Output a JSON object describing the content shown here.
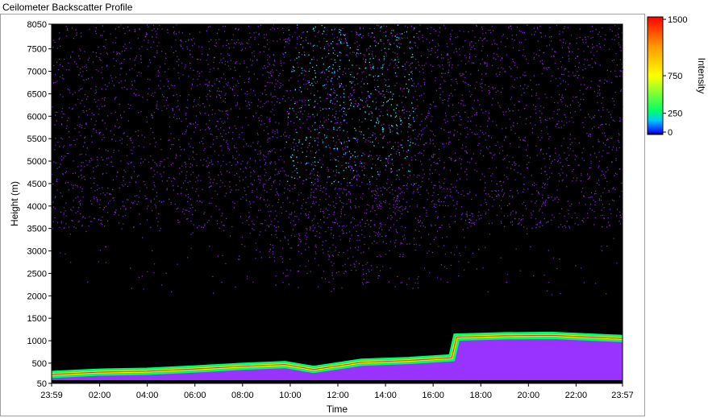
{
  "window": {
    "title": "Ceilometer Backscatter Profile"
  },
  "chart_data": {
    "type": "heatmap",
    "title": "",
    "xlabel": "Time",
    "ylabel": "Height (m)",
    "x_ticks": [
      "23:59",
      "02:00",
      "04:00",
      "06:00",
      "08:00",
      "10:00",
      "12:00",
      "14:00",
      "16:00",
      "18:00",
      "20:00",
      "22:00",
      "23:57"
    ],
    "y_ticks": [
      50,
      500,
      1000,
      1500,
      2000,
      2500,
      3000,
      3500,
      4000,
      4500,
      5000,
      5500,
      6000,
      6500,
      7000,
      7500,
      8050
    ],
    "xlim": [
      "23:59",
      "23:57"
    ],
    "ylim": [
      50,
      8050
    ],
    "colorbar": {
      "label": "Intensity",
      "ticks": [
        0,
        250,
        750,
        1500
      ],
      "range": [
        0,
        1500
      ]
    },
    "boundary_layer_top": {
      "time_h": [
        0,
        2,
        4,
        6,
        8,
        9.8,
        11,
        13,
        15,
        16.8,
        17,
        19,
        21,
        23.97
      ],
      "height_m": [
        250,
        300,
        320,
        370,
        430,
        470,
        360,
        520,
        560,
        620,
        1080,
        1110,
        1120,
        1050
      ]
    },
    "colors": {
      "background": "#000000",
      "scatter": "#8a28e0",
      "scatter_bright": "#33e0ff",
      "fill_low": "#9933ff",
      "band_mid": "#00ff66",
      "band_high": "#ff2a00"
    }
  }
}
